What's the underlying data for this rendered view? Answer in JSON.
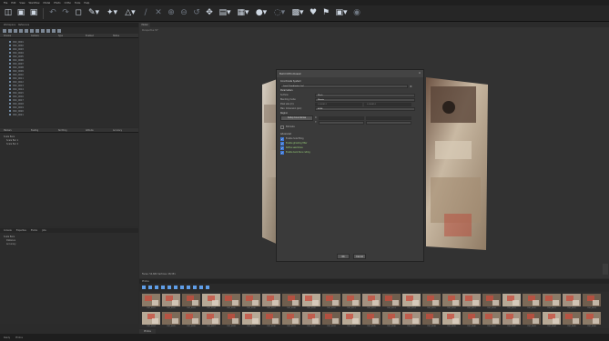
{
  "menubar": {
    "items": [
      "File",
      "Edit",
      "View",
      "Workflow",
      "Model",
      "Photo",
      "Ortho",
      "Tools",
      "Help"
    ]
  },
  "toolbar": {
    "icons": [
      "open-icon",
      "save-icon",
      "save-as-icon",
      "undo-icon",
      "redo-icon",
      "select-icon",
      "draw-icon",
      "navigation-icon",
      "ruler-icon",
      "zoom-in-icon",
      "zoom-out-icon",
      "rotate-icon",
      "model-view-icon",
      "texture-icon",
      "shading-icon",
      "camera-icon",
      "marker-icon",
      "photo-icon"
    ]
  },
  "workspace": {
    "tabs": [
      "Workspace",
      "Reference"
    ],
    "columns": [
      "Chunks",
      "Camera",
      "Type",
      "Enabled",
      "Status"
    ],
    "tree": [
      "DSC_0001",
      "DSC_0002",
      "DSC_0003",
      "DSC_0004",
      "DSC_0005",
      "DSC_0006",
      "DSC_0007",
      "DSC_0008",
      "DSC_0009",
      "DSC_0010",
      "DSC_0011",
      "DSC_0012",
      "DSC_0013",
      "DSC_0014",
      "DSC_0015",
      "DSC_0016",
      "DSC_0017",
      "DSC_0018",
      "DSC_0019",
      "DSC_0020",
      "DSC_0021"
    ]
  },
  "reference": {
    "columns": [
      "Markers",
      "Easting",
      "Northing",
      "Altitude",
      "Accuracy"
    ],
    "heading": "Scale Bars",
    "items": [
      "Scale Bar 1",
      "Scale Bar 2"
    ]
  },
  "properties": {
    "tabs": [
      "Console",
      "Properties",
      "Photos",
      "Jobs"
    ],
    "heading": "Scale Bars",
    "items": [
      "Distance",
      "Accuracy"
    ]
  },
  "model": {
    "tab": "Model",
    "viewport_label": "Perspective 30°",
    "status_info": "Faces: 54,684  Vertices: 28,351"
  },
  "dialog": {
    "title": "Build Orthomosaic",
    "projection_section": "Coordinate System",
    "projection_value": "Local Coordinates (m)",
    "general_section": "Parameters",
    "surface_label": "Surface:",
    "surface_value": "Mesh",
    "blending_label": "Blending mode:",
    "blending_value": "Mosaic",
    "pixel_label": "Pixel size (m):",
    "pixel_x": "0.000412",
    "pixel_y": "0.000412",
    "max_dim_label": "Max. dimension (pix):",
    "max_dim_value": "4096",
    "region_label": "Region",
    "setup_button": "Setup boundaries",
    "x_label": "X:",
    "y_label": "Y:",
    "estimate_label": "Estimate",
    "advanced_section": "Advanced",
    "hole_filling": "Enable hole filling",
    "ghosting": "Enable ghosting filter",
    "refine": "Refine seamlines",
    "backface": "Enable back-face culling",
    "ok_label": "OK",
    "cancel_label": "Cancel"
  },
  "photos": {
    "header": "Photos",
    "tab": "Photos",
    "thumb_labels": [
      "DSC_0001",
      "DSC_0002",
      "DSC_0003",
      "DSC_0004",
      "DSC_0005",
      "DSC_0006",
      "DSC_0007",
      "DSC_0008",
      "DSC_0009",
      "DSC_0010",
      "DSC_0011",
      "DSC_0012",
      "DSC_0013",
      "DSC_0014",
      "DSC_0015",
      "DSC_0016",
      "DSC_0017",
      "DSC_0018",
      "DSC_0019",
      "DSC_0020",
      "DSC_0021",
      "DSC_0022",
      "DSC_0023",
      "DSC_0024",
      "DSC_0025",
      "DSC_0026",
      "DSC_0027",
      "DSC_0028",
      "DSC_0029",
      "DSC_0030",
      "DSC_0031",
      "DSC_0032",
      "DSC_0033",
      "DSC_0034",
      "DSC_0035",
      "DSC_0036",
      "DSC_0037",
      "DSC_0038",
      "DSC_0039",
      "DSC_0040",
      "DSC_0041",
      "DSC_0042",
      "DSC_0043",
      "DSC_0044",
      "DSC_0045",
      "DSC_0046"
    ]
  },
  "statusbar": {
    "left": "Ready",
    "center": "Photos"
  },
  "colors": {
    "accent": "#3e78d6",
    "background": "#2b2b2b",
    "dialog": "#3a3a3a"
  }
}
